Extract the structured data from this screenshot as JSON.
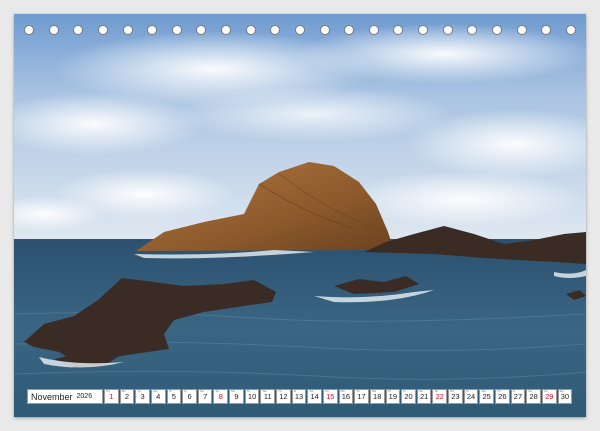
{
  "calendar": {
    "month": "November",
    "year": "2026",
    "days": [
      {
        "d": "1",
        "wd": "Su",
        "sun": true
      },
      {
        "d": "2",
        "wd": "Mo"
      },
      {
        "d": "3",
        "wd": "Tu"
      },
      {
        "d": "4",
        "wd": "We"
      },
      {
        "d": "5",
        "wd": "Th"
      },
      {
        "d": "6",
        "wd": "Fr"
      },
      {
        "d": "7",
        "wd": "Sa"
      },
      {
        "d": "8",
        "wd": "Su",
        "sun": true
      },
      {
        "d": "9",
        "wd": "Mo"
      },
      {
        "d": "10",
        "wd": "Tu"
      },
      {
        "d": "11",
        "wd": "We"
      },
      {
        "d": "12",
        "wd": "Th"
      },
      {
        "d": "13",
        "wd": "Fr"
      },
      {
        "d": "14",
        "wd": "Sa"
      },
      {
        "d": "15",
        "wd": "Su",
        "sun": true
      },
      {
        "d": "16",
        "wd": "Mo"
      },
      {
        "d": "17",
        "wd": "Tu"
      },
      {
        "d": "18",
        "wd": "We"
      },
      {
        "d": "19",
        "wd": "Th"
      },
      {
        "d": "20",
        "wd": "Fr"
      },
      {
        "d": "21",
        "wd": "Sa"
      },
      {
        "d": "22",
        "wd": "Su",
        "sun": true
      },
      {
        "d": "23",
        "wd": "Mo"
      },
      {
        "d": "24",
        "wd": "Tu"
      },
      {
        "d": "25",
        "wd": "We"
      },
      {
        "d": "26",
        "wd": "Th"
      },
      {
        "d": "27",
        "wd": "Fr"
      },
      {
        "d": "28",
        "wd": "Sa"
      },
      {
        "d": "29",
        "wd": "Su",
        "sun": true
      },
      {
        "d": "30",
        "wd": "Mo"
      }
    ],
    "sunday_color": "#d0102a"
  },
  "binding": {
    "ring_count": 23,
    "ring_icon": "binding-ring-icon"
  },
  "photo": {
    "subject": "coastal-rock-landscape"
  }
}
